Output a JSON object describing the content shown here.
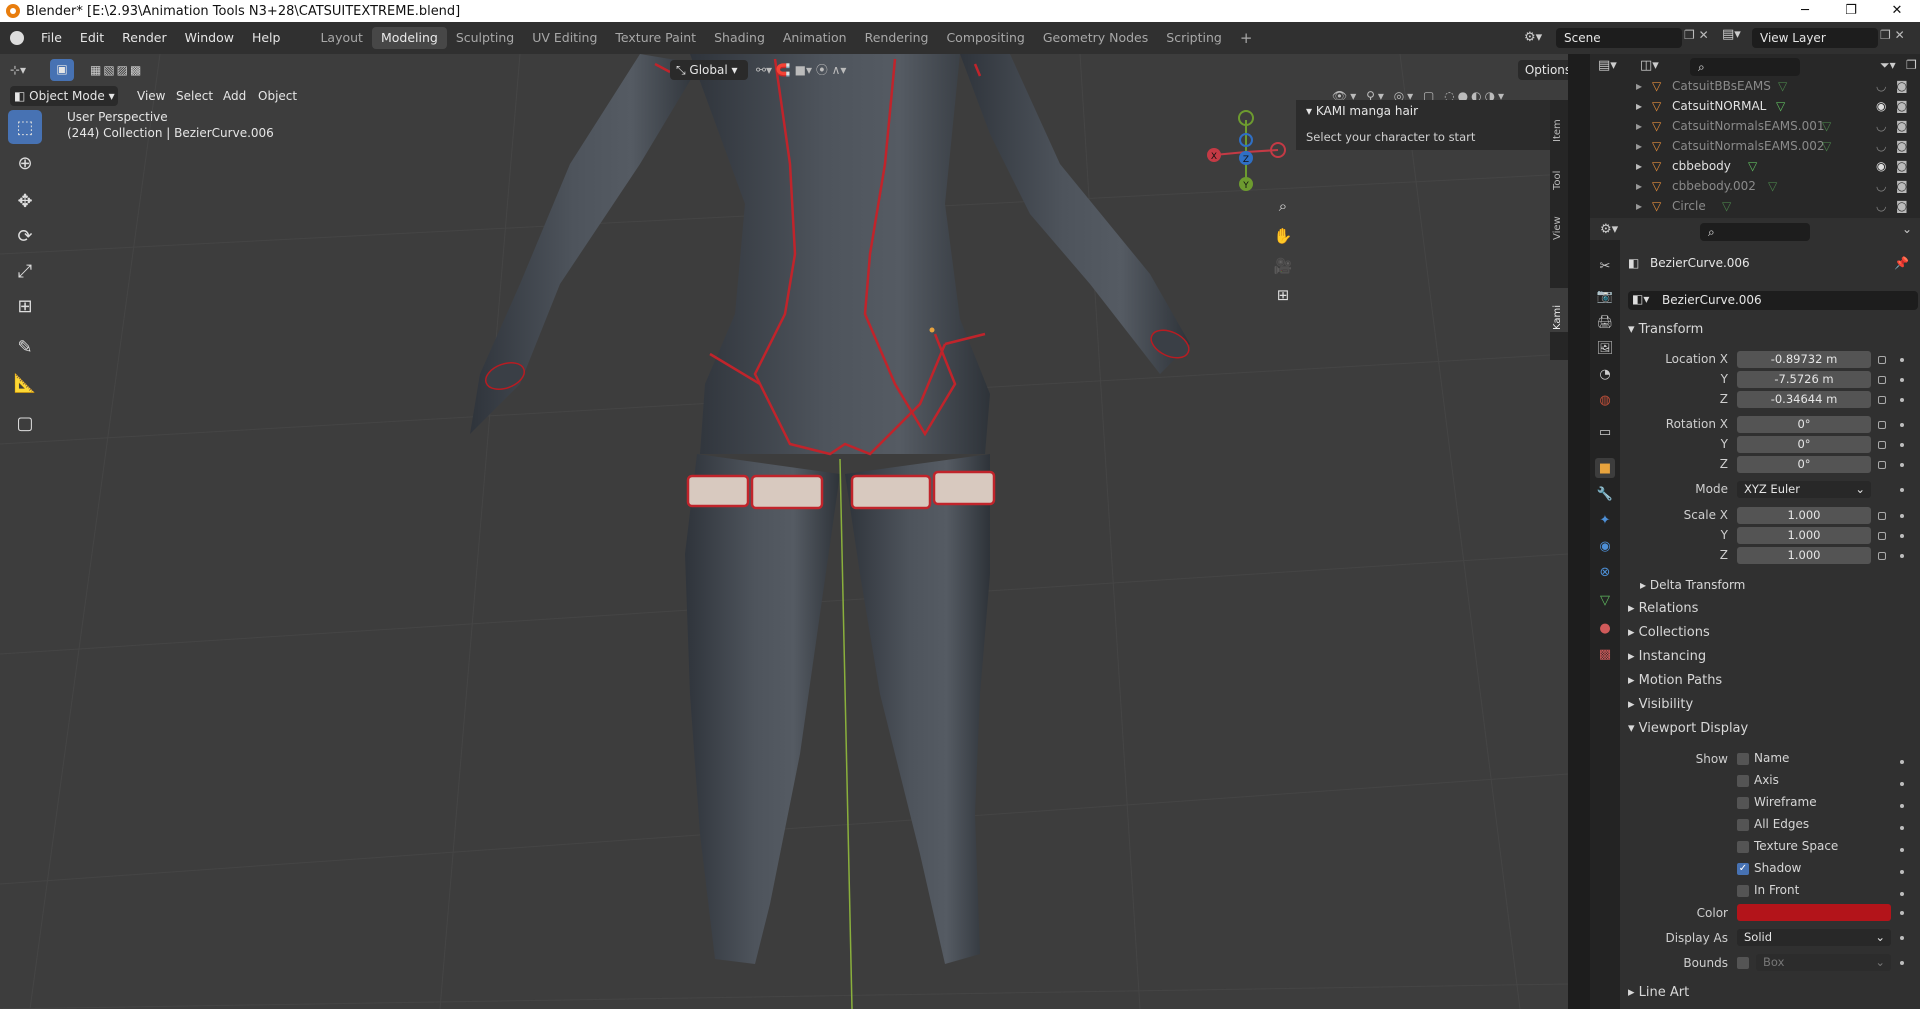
{
  "window": {
    "title": "Blender* [E:\\2.93\\Animation Tools N3+28\\CATSUITEXTREME.blend]"
  },
  "menu": [
    "File",
    "Edit",
    "Render",
    "Window",
    "Help"
  ],
  "workspaces": [
    "Layout",
    "Modeling",
    "Sculpting",
    "UV Editing",
    "Texture Paint",
    "Shading",
    "Animation",
    "Rendering",
    "Compositing",
    "Geometry Nodes",
    "Scripting"
  ],
  "active_workspace": "Modeling",
  "scene": {
    "name": "Scene",
    "view_layer": "View Layer"
  },
  "viewport": {
    "mode": "Object Mode",
    "menus": [
      "View",
      "Select",
      "Add",
      "Object"
    ],
    "orientation": "Global",
    "options_label": "Options",
    "overlay_line1": "User Perspective",
    "overlay_line2": "(244) Collection | BezierCurve.006",
    "gizmo_axes": [
      "X",
      "Y",
      "Z"
    ],
    "sidebar_tabs": [
      "Item",
      "Tool",
      "View",
      "Kami"
    ],
    "kami_panel": {
      "title": "KAMI manga hair",
      "text": "Select your character to start"
    }
  },
  "outliner": {
    "items": [
      {
        "name": "CatsuitBBsEAMS",
        "dim": true
      },
      {
        "name": "CatsuitNORMAL",
        "dim": false
      },
      {
        "name": "CatsuitNormalsEAMS.001",
        "dim": true
      },
      {
        "name": "CatsuitNormalsEAMS.002",
        "dim": true
      },
      {
        "name": "cbbebody",
        "dim": false
      },
      {
        "name": "cbbebody.002",
        "dim": true
      },
      {
        "name": "Circle",
        "dim": true
      }
    ]
  },
  "properties": {
    "object_name": "BezierCurve.006",
    "data_name": "BezierCurve.006",
    "transform": {
      "title": "Transform",
      "location_label": "Location X",
      "location": [
        "-0.89732 m",
        "-7.5726 m",
        "-0.34644 m"
      ],
      "rotation_label": "Rotation X",
      "rotation": [
        "0°",
        "0°",
        "0°"
      ],
      "mode_label": "Mode",
      "mode": "XYZ Euler",
      "scale_label": "Scale X",
      "scale": [
        "1.000",
        "1.000",
        "1.000"
      ],
      "axis_y": "Y",
      "axis_z": "Z",
      "delta": "Delta Transform"
    },
    "sections": [
      "Relations",
      "Collections",
      "Instancing",
      "Motion Paths",
      "Visibility"
    ],
    "viewport_display": {
      "title": "Viewport Display",
      "show_label": "Show",
      "checks": [
        {
          "label": "Name",
          "checked": false
        },
        {
          "label": "Axis",
          "checked": false
        },
        {
          "label": "Wireframe",
          "checked": false
        },
        {
          "label": "All Edges",
          "checked": false
        },
        {
          "label": "Texture Space",
          "checked": false
        },
        {
          "label": "Shadow",
          "checked": true
        },
        {
          "label": "In Front",
          "checked": false
        }
      ],
      "color_label": "Color",
      "color": "#b3141a",
      "display_as_label": "Display As",
      "display_as": "Solid",
      "bounds_label": "Bounds",
      "bounds": "Box"
    },
    "line_art": "Line Art"
  }
}
